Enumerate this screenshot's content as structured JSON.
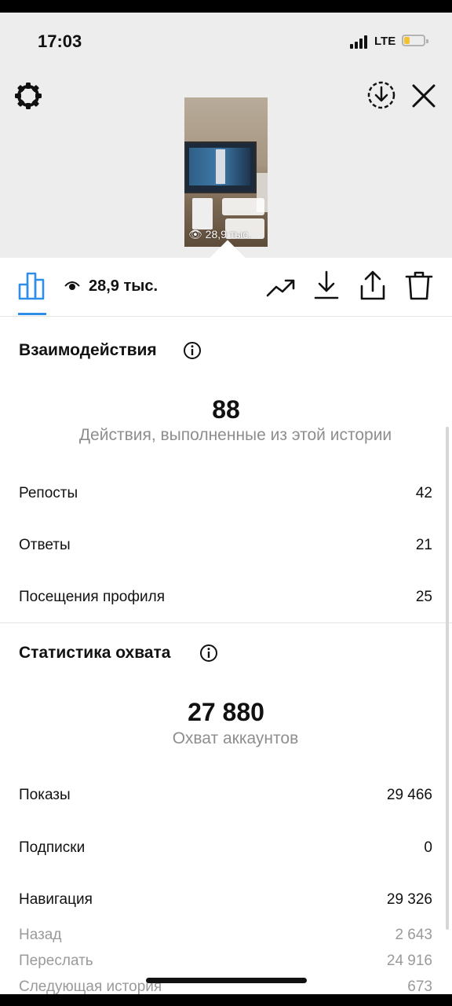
{
  "status_bar": {
    "time": "17:03",
    "network": "LTE",
    "battery_color": "#f2c230"
  },
  "header": {
    "settings_icon": "gear-icon",
    "save_icon": "download-circle-icon",
    "close_icon": "close-icon",
    "thumbnail_views": "28,9 тыс."
  },
  "tabs": {
    "active_icon": "bar-chart-icon",
    "views_icon": "eye-icon",
    "views": "28,9 тыс.",
    "actions": [
      "trend-icon",
      "download-icon",
      "share-icon",
      "trash-icon"
    ],
    "accent_color": "#2f8fe8"
  },
  "interactions": {
    "title": "Взаимодействия",
    "total": "88",
    "caption": "Действия, выполненные из этой истории",
    "rows": [
      {
        "label": "Репосты",
        "value": "42"
      },
      {
        "label": "Ответы",
        "value": "21"
      },
      {
        "label": "Посещения профиля",
        "value": "25"
      }
    ]
  },
  "reach": {
    "title": "Статистика охвата",
    "total": "27 880",
    "caption": "Охват аккаунтов",
    "rows": [
      {
        "label": "Показы",
        "value": "29 466"
      },
      {
        "label": "Подписки",
        "value": "0"
      },
      {
        "label": "Навигация",
        "value": "29 326"
      }
    ],
    "sub_rows": [
      {
        "label": "Назад",
        "value": "2 643"
      },
      {
        "label": "Переслать",
        "value": "24 916"
      },
      {
        "label": "Следующая история",
        "value": "673"
      }
    ]
  }
}
